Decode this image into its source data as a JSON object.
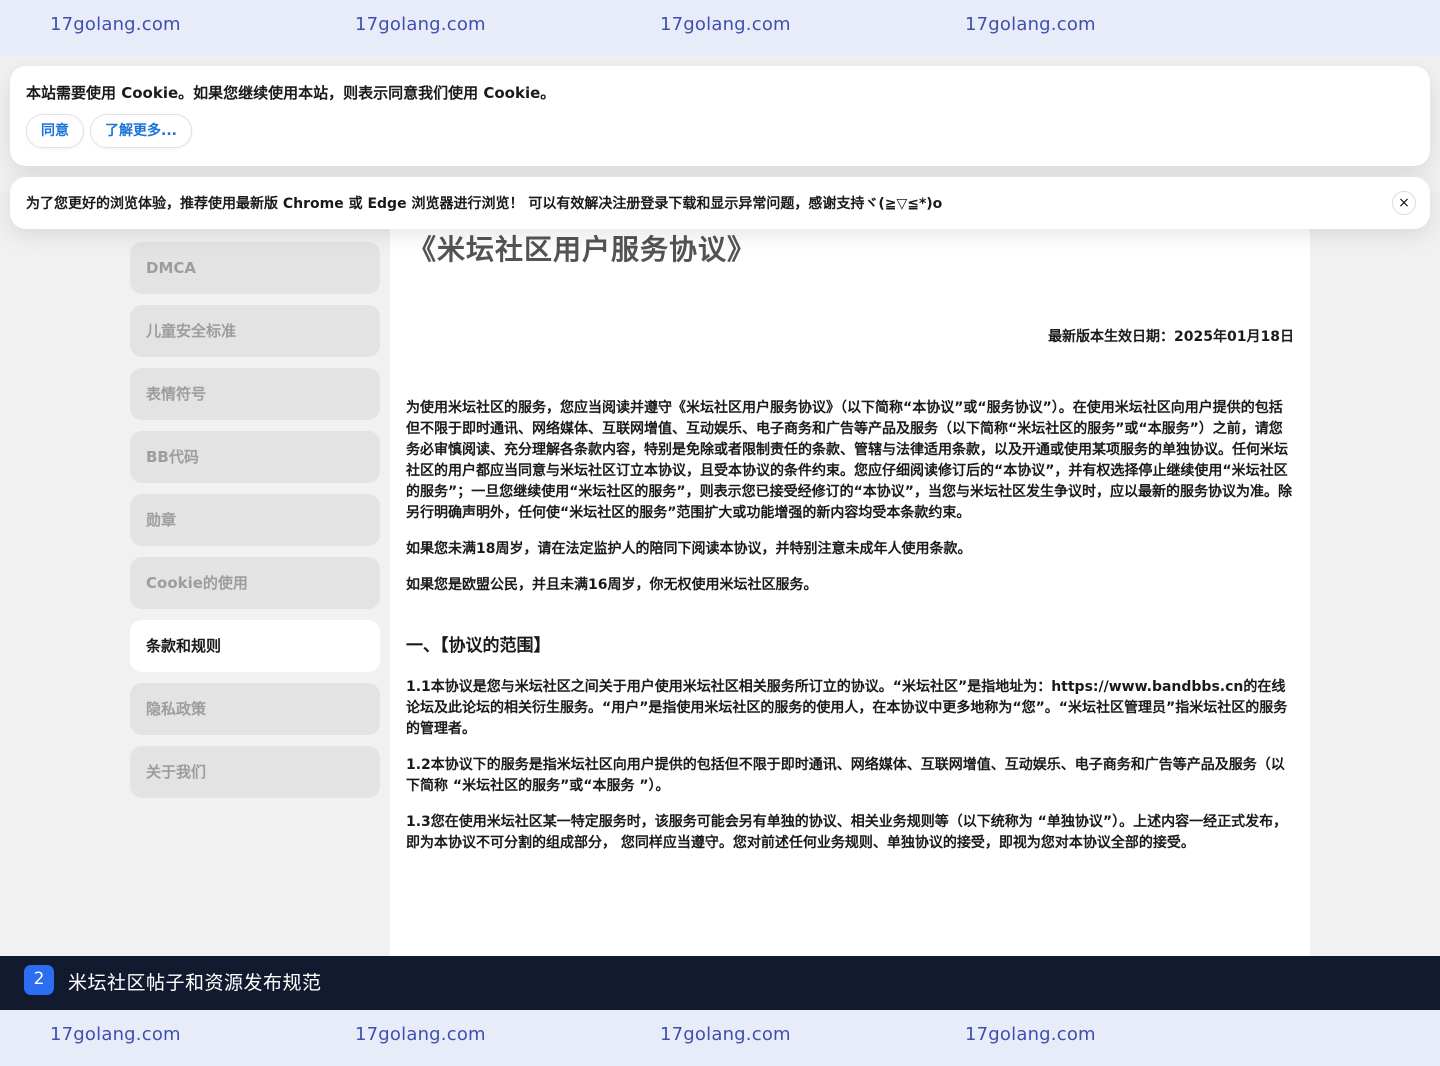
{
  "watermark": {
    "text": "17golang.com"
  },
  "cookie_notice": {
    "message": "本站需要使用 Cookie。如果您继续使用本站，则表示同意我们使用 Cookie。",
    "agree_label": "同意",
    "learn_more_label": "了解更多..."
  },
  "browser_notice": {
    "message": "为了您更好的浏览体验，推荐使用最新版 Chrome 或 Edge 浏览器进行浏览！ 可以有效解决注册登录下载和显示异常问题，感谢支持ヾ(≧▽≦*)o",
    "close_icon": "×"
  },
  "sidebar": {
    "items": [
      {
        "label": "DMCA",
        "active": false
      },
      {
        "label": "儿童安全标准",
        "active": false
      },
      {
        "label": "表情符号",
        "active": false
      },
      {
        "label": "BB代码",
        "active": false
      },
      {
        "label": "勋章",
        "active": false
      },
      {
        "label": "Cookie的使用",
        "active": false
      },
      {
        "label": "条款和规则",
        "active": true
      },
      {
        "label": "隐私政策",
        "active": false
      },
      {
        "label": "关于我们",
        "active": false
      }
    ]
  },
  "document": {
    "title": "《米坛社区用户服务协议》",
    "effective_date": "最新版本生效日期：2025年01月18日",
    "intro": "为使用米坛社区的服务，您应当阅读并遵守《米坛社区用户服务协议》（以下简称“本协议”或“服务协议”）。在使用米坛社区向用户提供的包括但不限于即时通讯、网络媒体、互联网增值、互动娱乐、电子商务和广告等产品及服务（以下简称“米坛社区的服务”或“本服务”）之前，请您务必审慎阅读、充分理解各条款内容，特别是免除或者限制责任的条款、管辖与法律适用条款，以及开通或使用某项服务的单独协议。任何米坛社区的用户都应当同意与米坛社区订立本协议，且受本协议的条件约束。您应仔细阅读修订后的“本协议”，并有权选择停止继续使用“米坛社区的服务”；一旦您继续使用“米坛社区的服务”，则表示您已接受经修订的“本协议”，当您与米坛社区发生争议时，应以最新的服务协议为准。除另行明确声明外，任何使“米坛社区的服务”范围扩大或功能增强的新内容均受本条款约束。",
    "minor_notice": "如果您未满18周岁，请在法定监护人的陪同下阅读本协议，并特别注意未成年人使用条款。",
    "eu_notice": "如果您是欧盟公民，并且未满16周岁，你无权使用米坛社区服务。",
    "section1_heading": "一、【协议的范围】",
    "clause_1_1": "1.1本协议是您与米坛社区之间关于用户使用米坛社区相关服务所订立的协议。“米坛社区”是指地址为：https://www.bandbbs.cn的在线论坛及此论坛的相关衍生服务。“用户”是指使用米坛社区的服务的使用人，在本协议中更多地称为“您”。“米坛社区管理员”指米坛社区的服务的管理者。",
    "clause_1_2": "1.2本协议下的服务是指米坛社区向用户提供的包括但不限于即时通讯、网络媒体、互联网增值、互动娱乐、电子商务和广告等产品及服务（以下简称 “米坛社区的服务”或“本服务 ”）。",
    "clause_1_3": "1.3您在使用米坛社区某一特定服务时，该服务可能会另有单独的协议、相关业务规则等（以下统称为 “单独协议”）。上述内容一经正式发布，即为本协议不可分割的组成部分， 您同样应当遵守。您对前述任何业务规则、单独协议的接受，即视为您对本协议全部的接受。"
  },
  "bottom_banner": {
    "number": "2",
    "title": "米坛社区帖子和资源发布规范"
  },
  "colors": {
    "accent_blue": "#2b6ef2",
    "link_blue": "#1a73d9",
    "banner_bg": "#111a2e",
    "watermark_bg": "#e8ecf8",
    "watermark_text": "#3e4fb0"
  }
}
